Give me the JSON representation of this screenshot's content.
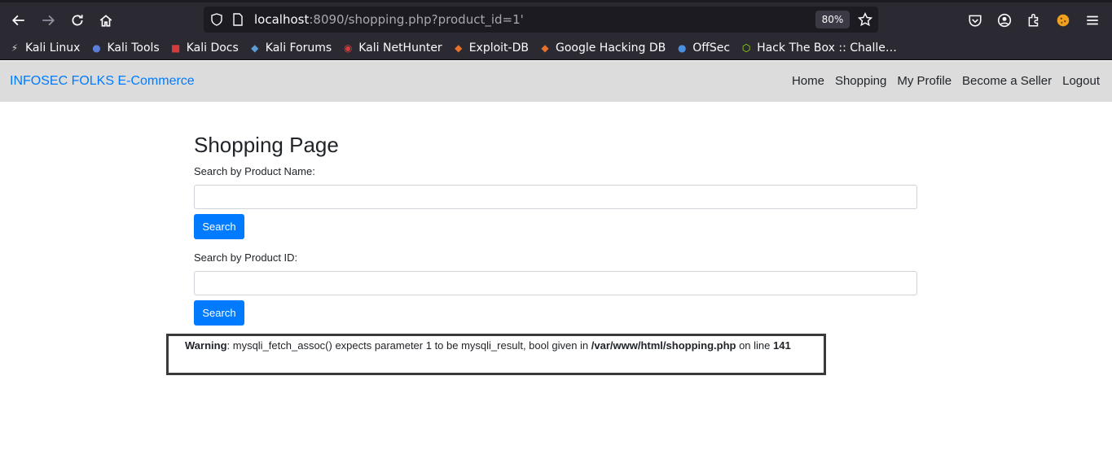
{
  "browser": {
    "url_host": "localhost",
    "url_rest": ":8090/shopping.php?product_id=1'",
    "zoom": "80%",
    "bookmarks": [
      {
        "label": "Kali Linux",
        "icon": "kali-dragon-icon",
        "color": "#d0d0d0"
      },
      {
        "label": "Kali Tools",
        "icon": "kali-tools-icon",
        "color": "#5b7fd6"
      },
      {
        "label": "Kali Docs",
        "icon": "kali-docs-icon",
        "color": "#d63b3b"
      },
      {
        "label": "Kali Forums",
        "icon": "kali-forums-icon",
        "color": "#5b9bd6"
      },
      {
        "label": "Kali NetHunter",
        "icon": "nethunter-icon",
        "color": "#d63b3b"
      },
      {
        "label": "Exploit-DB",
        "icon": "exploit-db-icon",
        "color": "#e8702a"
      },
      {
        "label": "Google Hacking DB",
        "icon": "ghdb-icon",
        "color": "#e8702a"
      },
      {
        "label": "OffSec",
        "icon": "offsec-icon",
        "color": "#4a8fe0"
      },
      {
        "label": "Hack The Box :: Challe…",
        "icon": "htb-icon",
        "color": "#9fef00"
      }
    ]
  },
  "site": {
    "brand": "INFOSEC FOLKS E-Commerce",
    "menu": [
      "Home",
      "Shopping",
      "My Profile",
      "Become a Seller",
      "Logout"
    ]
  },
  "main": {
    "title": "Shopping Page",
    "name_label": "Search by Product Name:",
    "name_value": "",
    "search_label": "Search",
    "id_label": "Search by Product ID:",
    "id_value": "",
    "search2_label": "Search"
  },
  "warning": {
    "prefix": "Warning",
    "message": ": mysqli_fetch_assoc() expects parameter 1 to be mysqli_result, bool given in ",
    "file": "/var/www/html/shopping.php",
    "on_line": " on line ",
    "line": "141"
  }
}
